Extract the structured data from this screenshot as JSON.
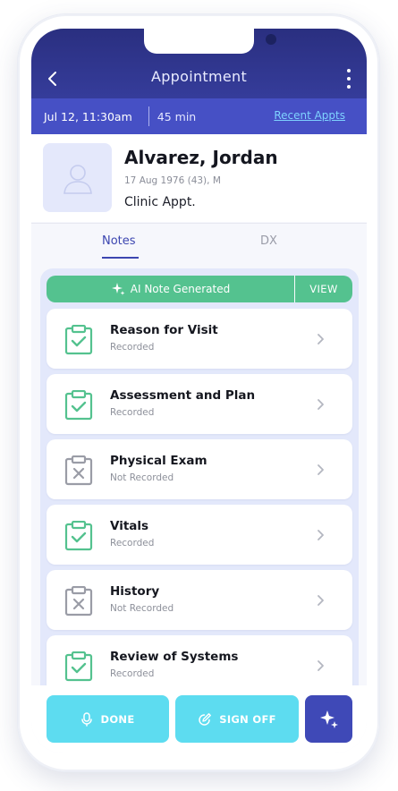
{
  "header": {
    "title": "Appointment",
    "back_icon": "chevron-left-icon",
    "menu_icon": "kebab-menu-icon"
  },
  "subbar": {
    "datetime": "Jul 12, 11:30am",
    "duration": "45 min",
    "recent_link": "Recent Appts"
  },
  "patient": {
    "name": "Alvarez, Jordan",
    "dob": "17 Aug 1976 (43), M",
    "visit_type": "Clinic Appt."
  },
  "tabs": [
    {
      "label": "Notes",
      "active": true
    },
    {
      "label": "DX",
      "active": false
    }
  ],
  "ai_note": {
    "label": "AI Note Generated",
    "view_label": "VIEW"
  },
  "items": [
    {
      "title": "Reason for Visit",
      "status": "Recorded",
      "recorded": true
    },
    {
      "title": "Assessment and Plan",
      "status": "Recorded",
      "recorded": true
    },
    {
      "title": "Physical Exam",
      "status": "Not Recorded",
      "recorded": false
    },
    {
      "title": "Vitals",
      "status": "Recorded",
      "recorded": true
    },
    {
      "title": "History",
      "status": "Not Recorded",
      "recorded": false
    },
    {
      "title": "Review of Systems",
      "status": "Recorded",
      "recorded": true
    }
  ],
  "actions": {
    "done_label": "DONE",
    "signoff_label": "SIGN OFF"
  },
  "colors": {
    "header_dark": "#2a2f80",
    "subbar": "#4650c5",
    "green": "#54c28f",
    "cyan_button": "#5ddcf0",
    "ai_button": "#3f49b7"
  }
}
